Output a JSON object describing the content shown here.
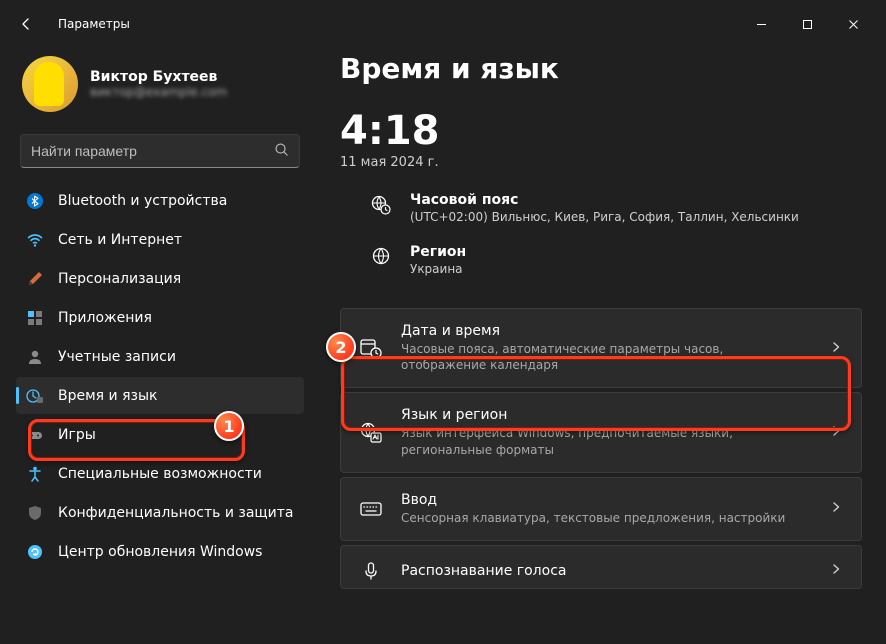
{
  "window": {
    "title": "Параметры"
  },
  "profile": {
    "name": "Виктор Бухтеев",
    "sub": "виктор@example.com"
  },
  "search": {
    "placeholder": "Найти параметр"
  },
  "sidebar": {
    "items": [
      {
        "label": "Bluetooth и устройства",
        "icon": "bluetooth"
      },
      {
        "label": "Сеть и Интернет",
        "icon": "wifi"
      },
      {
        "label": "Персонализация",
        "icon": "brush"
      },
      {
        "label": "Приложения",
        "icon": "apps"
      },
      {
        "label": "Учетные записи",
        "icon": "person"
      },
      {
        "label": "Время и язык",
        "icon": "time-lang",
        "active": true
      },
      {
        "label": "Игры",
        "icon": "gamepad"
      },
      {
        "label": "Специальные возможности",
        "icon": "accessibility"
      },
      {
        "label": "Конфиденциальность и защита",
        "icon": "shield"
      },
      {
        "label": "Центр обновления Windows",
        "icon": "update"
      }
    ]
  },
  "page": {
    "title": "Время и язык",
    "clock": "4:18",
    "date": "11 мая 2024 г.",
    "timezone": {
      "title": "Часовой пояс",
      "value": "(UTC+02:00) Вильнюс, Киев, Рига, София, Таллин, Хельсинки"
    },
    "region": {
      "title": "Регион",
      "value": "Украина"
    }
  },
  "cards": [
    {
      "title": "Дата и время",
      "sub": "Часовые пояса, автоматические параметры часов, отображение календаря",
      "icon": "calendar-clock"
    },
    {
      "title": "Язык и регион",
      "sub": "Язык интерфейса Windows, предпочитаемые языки, региональные форматы",
      "icon": "lang-region"
    },
    {
      "title": "Ввод",
      "sub": "Сенсорная клавиатура, текстовые предложения, настройки",
      "icon": "keyboard"
    },
    {
      "title": "Распознавание голоса",
      "sub": "",
      "icon": "mic"
    }
  ],
  "annotations": {
    "badge1": "1",
    "badge2": "2"
  }
}
